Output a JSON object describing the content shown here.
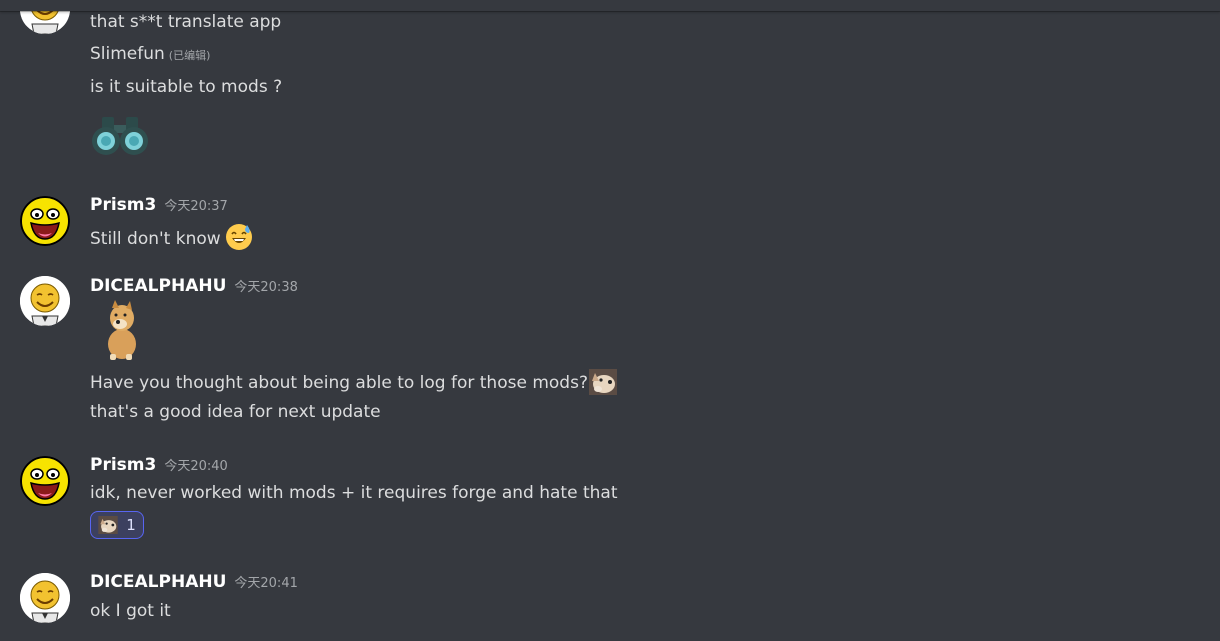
{
  "messages": {
    "m0": {
      "lines": [
        "that s**t translate app",
        "Slimefun",
        "is it suitable to mods ?"
      ],
      "edited_label": "(已编辑)",
      "sticker": "binoculars-emoji"
    },
    "m1": {
      "author": "Prism3",
      "timestamp": "今天20:37",
      "text": "Still don't know",
      "emoji": "sweat-smile-emoji"
    },
    "m2": {
      "author": "DICEALPHAHU",
      "timestamp": "今天20:38",
      "sticker": "cheems-doge-sticker",
      "lines": [
        "Have you thought about being able to log for those mods?",
        "that's a good idea for next update"
      ],
      "emoji": "doge-emoji"
    },
    "m3": {
      "author": "Prism3",
      "timestamp": "今天20:40",
      "text": "idk, never worked with mods + it requires forge and hate that",
      "reaction": {
        "emoji": "doge-emoji",
        "count": "1"
      }
    },
    "m4": {
      "author": "DICEALPHAHU",
      "timestamp": "今天20:41",
      "text": "ok I got it"
    }
  },
  "colors": {
    "background": "#36393f",
    "username": "#ffffff",
    "timestamp": "#a3a6aa",
    "reaction_border": "#5865f2"
  }
}
